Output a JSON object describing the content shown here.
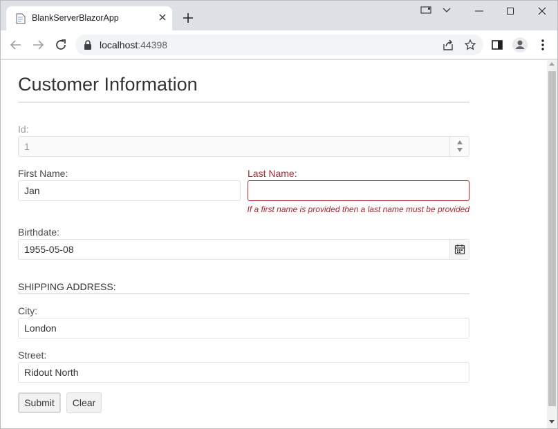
{
  "browser": {
    "tab_title": "BlankServerBlazorApp",
    "url_host": "localhost",
    "url_port": ":44398"
  },
  "form": {
    "title": "Customer Information",
    "id": {
      "label": "Id:",
      "value": "1"
    },
    "first_name": {
      "label": "First Name:",
      "value": "Jan"
    },
    "last_name": {
      "label": "Last Name:",
      "value": "",
      "error": "If a first name is provided then a last name must be provided"
    },
    "birthdate": {
      "label": "Birthdate:",
      "value": "1955-05-08"
    },
    "shipping_heading": "SHIPPING ADDRESS:",
    "city": {
      "label": "City:",
      "value": "London"
    },
    "street": {
      "label": "Street:",
      "value": "Ridout North"
    },
    "buttons": {
      "submit": "Submit",
      "clear": "Clear"
    }
  },
  "colors": {
    "error": "#b3262d",
    "tab_strip": "#dee1e6"
  }
}
